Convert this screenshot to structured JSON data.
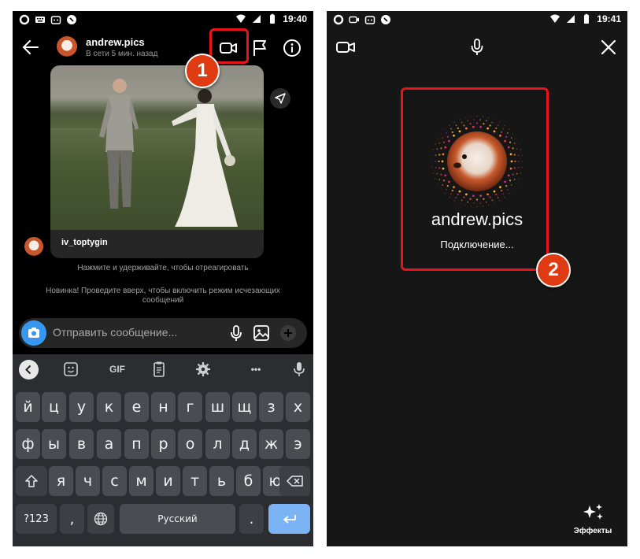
{
  "left_screen": {
    "status_bar": {
      "time": "19:40"
    },
    "header": {
      "username": "andrew.pics",
      "status": "В сети 5 мин. назад"
    },
    "message": {
      "sender": "iv_toptygin"
    },
    "hints": {
      "react": "Нажмите и удерживайте, чтобы отреагировать",
      "vanish": "Новинка! Проведите вверх, чтобы включить режим исчезающих сообщений"
    },
    "composer": {
      "placeholder": "Отправить сообщение..."
    },
    "keyboard": {
      "toolbar": {
        "gif_label": "GIF",
        "more_label": "•••"
      },
      "row1": [
        "й",
        "ц",
        "у",
        "к",
        "е",
        "н",
        "г",
        "ш",
        "щ",
        "з",
        "х"
      ],
      "row2": [
        "ф",
        "ы",
        "в",
        "а",
        "п",
        "р",
        "о",
        "л",
        "д",
        "ж",
        "э"
      ],
      "row3": [
        "я",
        "ч",
        "с",
        "м",
        "и",
        "т",
        "ь",
        "б",
        "ю"
      ],
      "symbols_label": "?123",
      "comma_label": ",",
      "space_label": "Русский",
      "period_label": "."
    },
    "marker_number": "1"
  },
  "right_screen": {
    "status_bar": {
      "time": "19:41"
    },
    "call": {
      "username": "andrew.pics",
      "status": "Подключение..."
    },
    "effects_label": "Эффекты",
    "marker_number": "2"
  },
  "colors": {
    "highlight": "#e8141c",
    "marker": "#e03a12",
    "accent_blue": "#3797f0",
    "enter_key": "#7cb3f4"
  }
}
